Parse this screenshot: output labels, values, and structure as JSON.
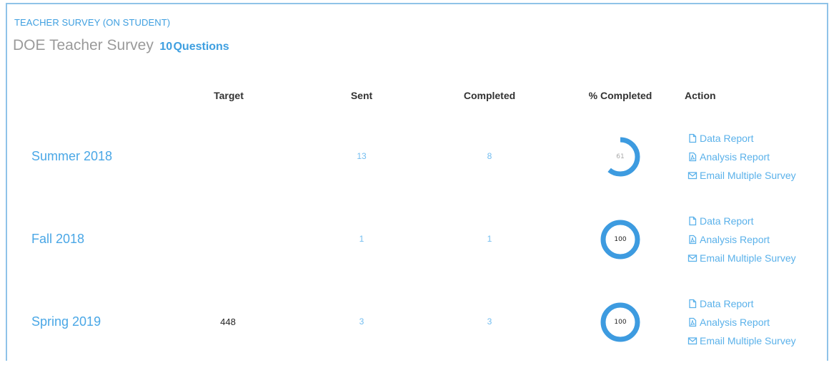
{
  "header": {
    "category": "TEACHER SURVEY (ON STUDENT)",
    "survey_title": "DOE Teacher Survey",
    "question_count": "10",
    "question_label": "Questions"
  },
  "columns": {
    "target": "Target",
    "sent": "Sent",
    "completed": "Completed",
    "percent_completed": "% Completed",
    "action": "Action"
  },
  "rows": [
    {
      "term": "Summer 2018",
      "target": "",
      "sent": "13",
      "completed": "8",
      "percent_completed": 61,
      "percent_label": "61",
      "actions": {
        "data_report": "Data Report",
        "analysis_report": "Analysis Report",
        "email_multiple": "Email Multiple Survey"
      }
    },
    {
      "term": "Fall 2018",
      "target": "",
      "sent": "1",
      "completed": "1",
      "percent_completed": 100,
      "percent_label": "100",
      "actions": {
        "data_report": "Data Report",
        "analysis_report": "Analysis Report",
        "email_multiple": "Email Multiple Survey"
      }
    },
    {
      "term": "Spring 2019",
      "target": "448",
      "sent": "3",
      "completed": "3",
      "percent_completed": 100,
      "percent_label": "100",
      "actions": {
        "data_report": "Data Report",
        "analysis_report": "Analysis Report",
        "email_multiple": "Email Multiple Survey"
      }
    }
  ],
  "colors": {
    "accent": "#4aa7e6",
    "donut": "#3d9be0",
    "panel_border": "#8fc3e8"
  },
  "icons": {
    "data_report": "file-icon",
    "analysis_report": "pdf-file-icon",
    "email_multiple": "envelope-icon"
  }
}
